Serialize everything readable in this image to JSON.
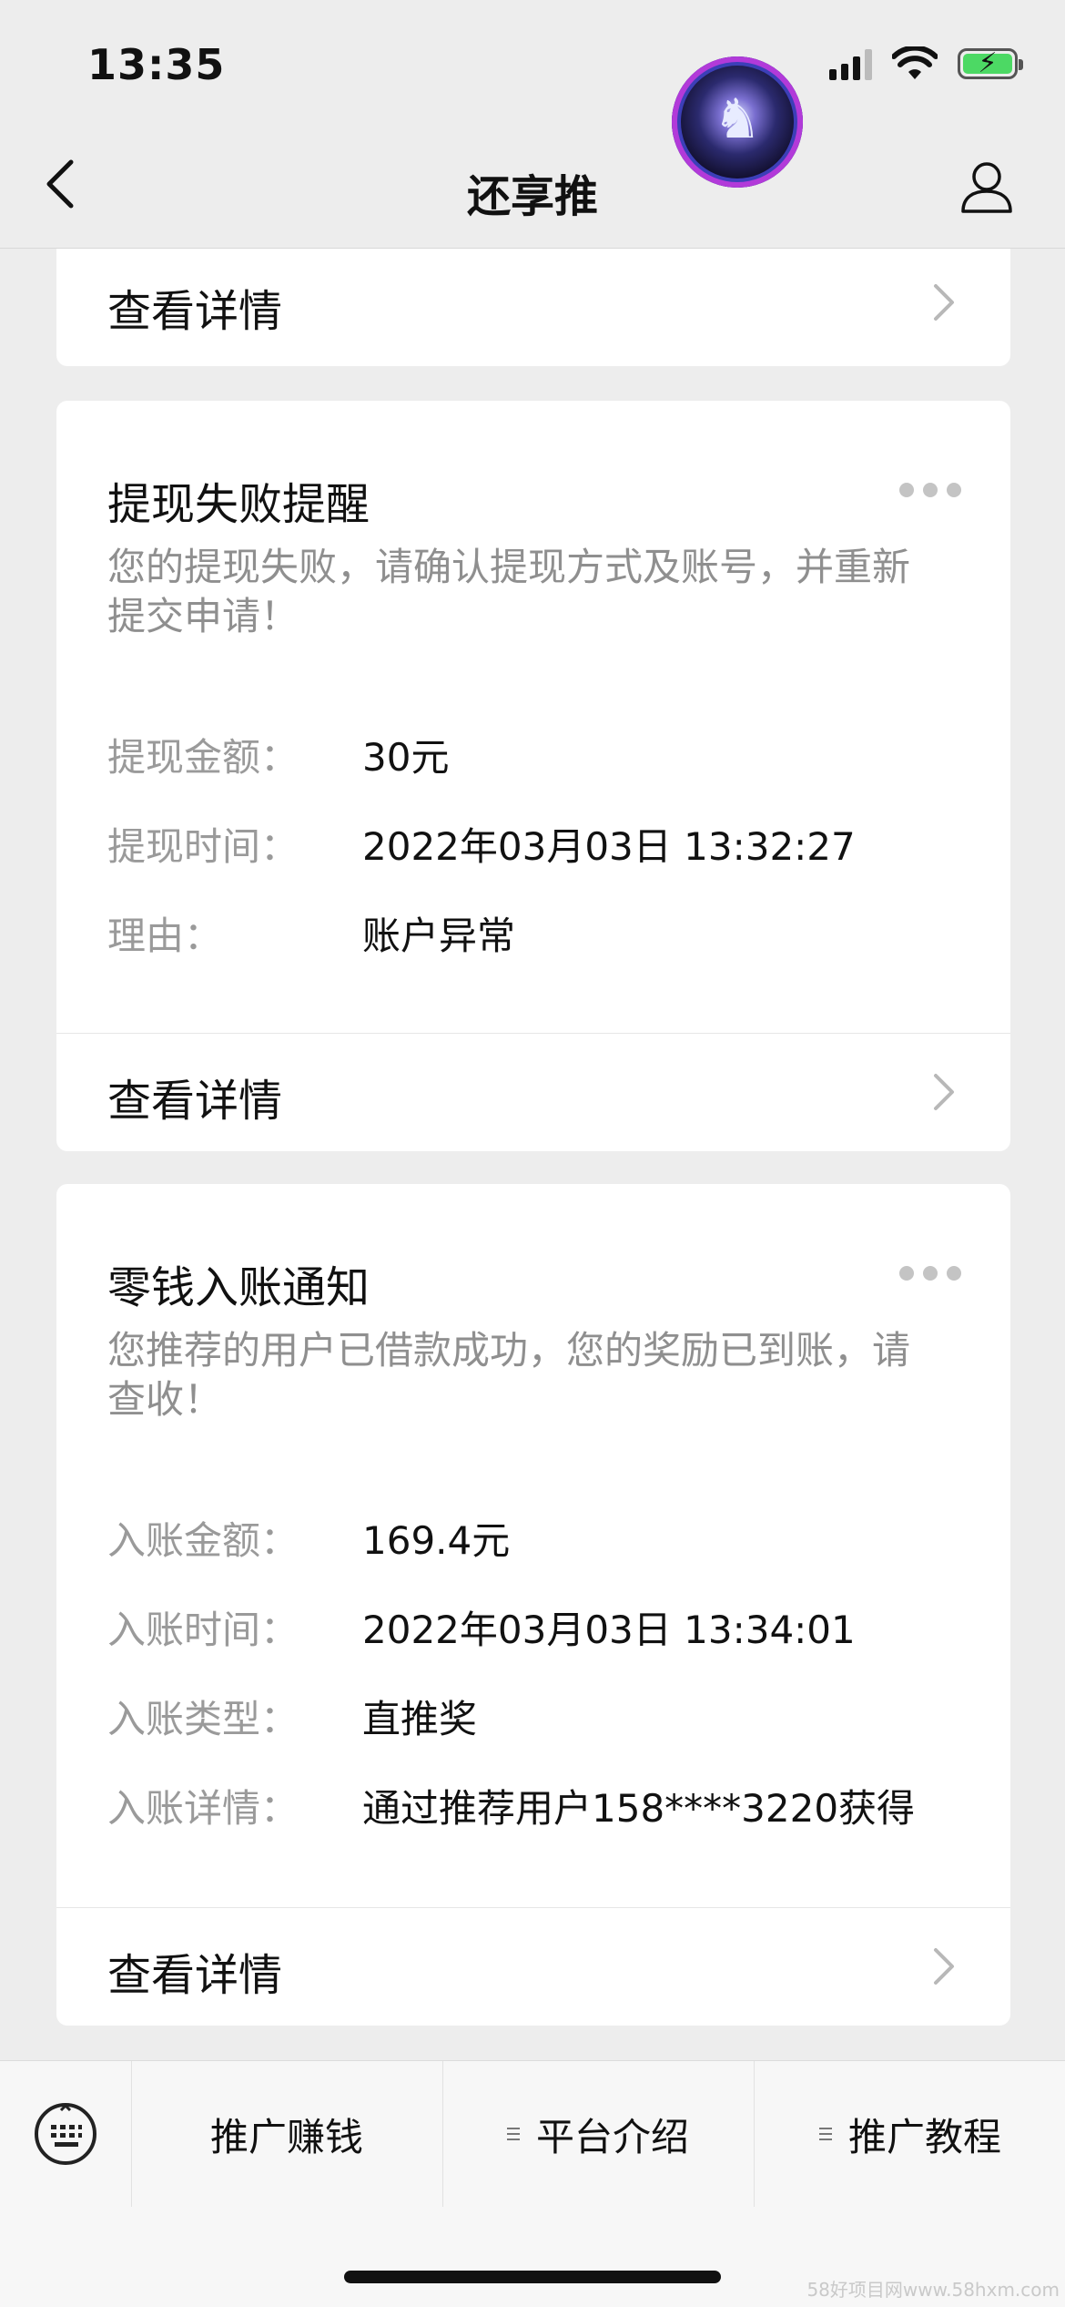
{
  "status_bar": {
    "time": "13:35"
  },
  "nav": {
    "title": "还享推"
  },
  "top_card": {
    "detail_label": "查看详情"
  },
  "withdraw_card": {
    "title": "提现失败提醒",
    "description": "您的提现失败，请确认提现方式及账号，并重新提交申请！",
    "fields": [
      {
        "key": "提现金额：",
        "value": "30元"
      },
      {
        "key": "提现时间：",
        "value": "2022年03月03日 13:32:27"
      },
      {
        "key": "理由：",
        "value": "账户异常"
      }
    ],
    "detail_label": "查看详情"
  },
  "income_card": {
    "title": "零钱入账通知",
    "description": "您推荐的用户已借款成功，您的奖励已到账，请查收！",
    "fields": [
      {
        "key": "入账金额：",
        "value": "169.4元"
      },
      {
        "key": "入账时间：",
        "value": "2022年03月03日 13:34:01"
      },
      {
        "key": "入账类型：",
        "value": "直推奖"
      },
      {
        "key": "入账详情：",
        "value": "通过推荐用户158****3220获得"
      }
    ],
    "detail_label": "查看详情"
  },
  "bottom_menu": {
    "items": [
      "推广赚钱",
      "平台介绍",
      "推广教程"
    ]
  },
  "watermark": "58好项目网www.58hxm.com",
  "colors": {
    "background": "#ededed",
    "card": "#ffffff",
    "muted_text": "#8f8f8f",
    "battery": "#4cd964"
  }
}
